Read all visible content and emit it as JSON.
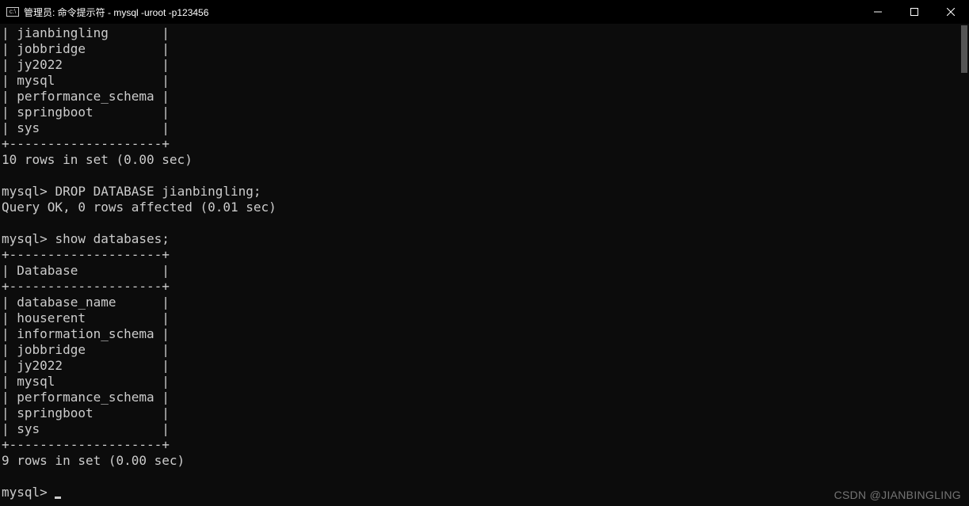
{
  "titlebar": {
    "title": "管理员: 命令提示符 - mysql  -uroot -p123456"
  },
  "terminal": {
    "table1_rows": [
      "jianbingling",
      "jobbridge",
      "jy2022",
      "mysql",
      "performance_schema",
      "springboot",
      "sys"
    ],
    "table1_border": "+--------------------+",
    "result1": "10 rows in set (0.00 sec)",
    "prompt1": "mysql> ",
    "cmd1": "DROP DATABASE jianbingling;",
    "response1": "Query OK, 0 rows affected (0.01 sec)",
    "prompt2": "mysql> ",
    "cmd2": "show databases;",
    "table2_border": "+--------------------+",
    "table2_header_cell": "Database",
    "table2_rows": [
      "database_name",
      "houserent",
      "information_schema",
      "jobbridge",
      "jy2022",
      "mysql",
      "performance_schema",
      "springboot",
      "sys"
    ],
    "result2": "9 rows in set (0.00 sec)",
    "prompt_final": "mysql> "
  },
  "watermark": "CSDN @JIANBINGLING"
}
